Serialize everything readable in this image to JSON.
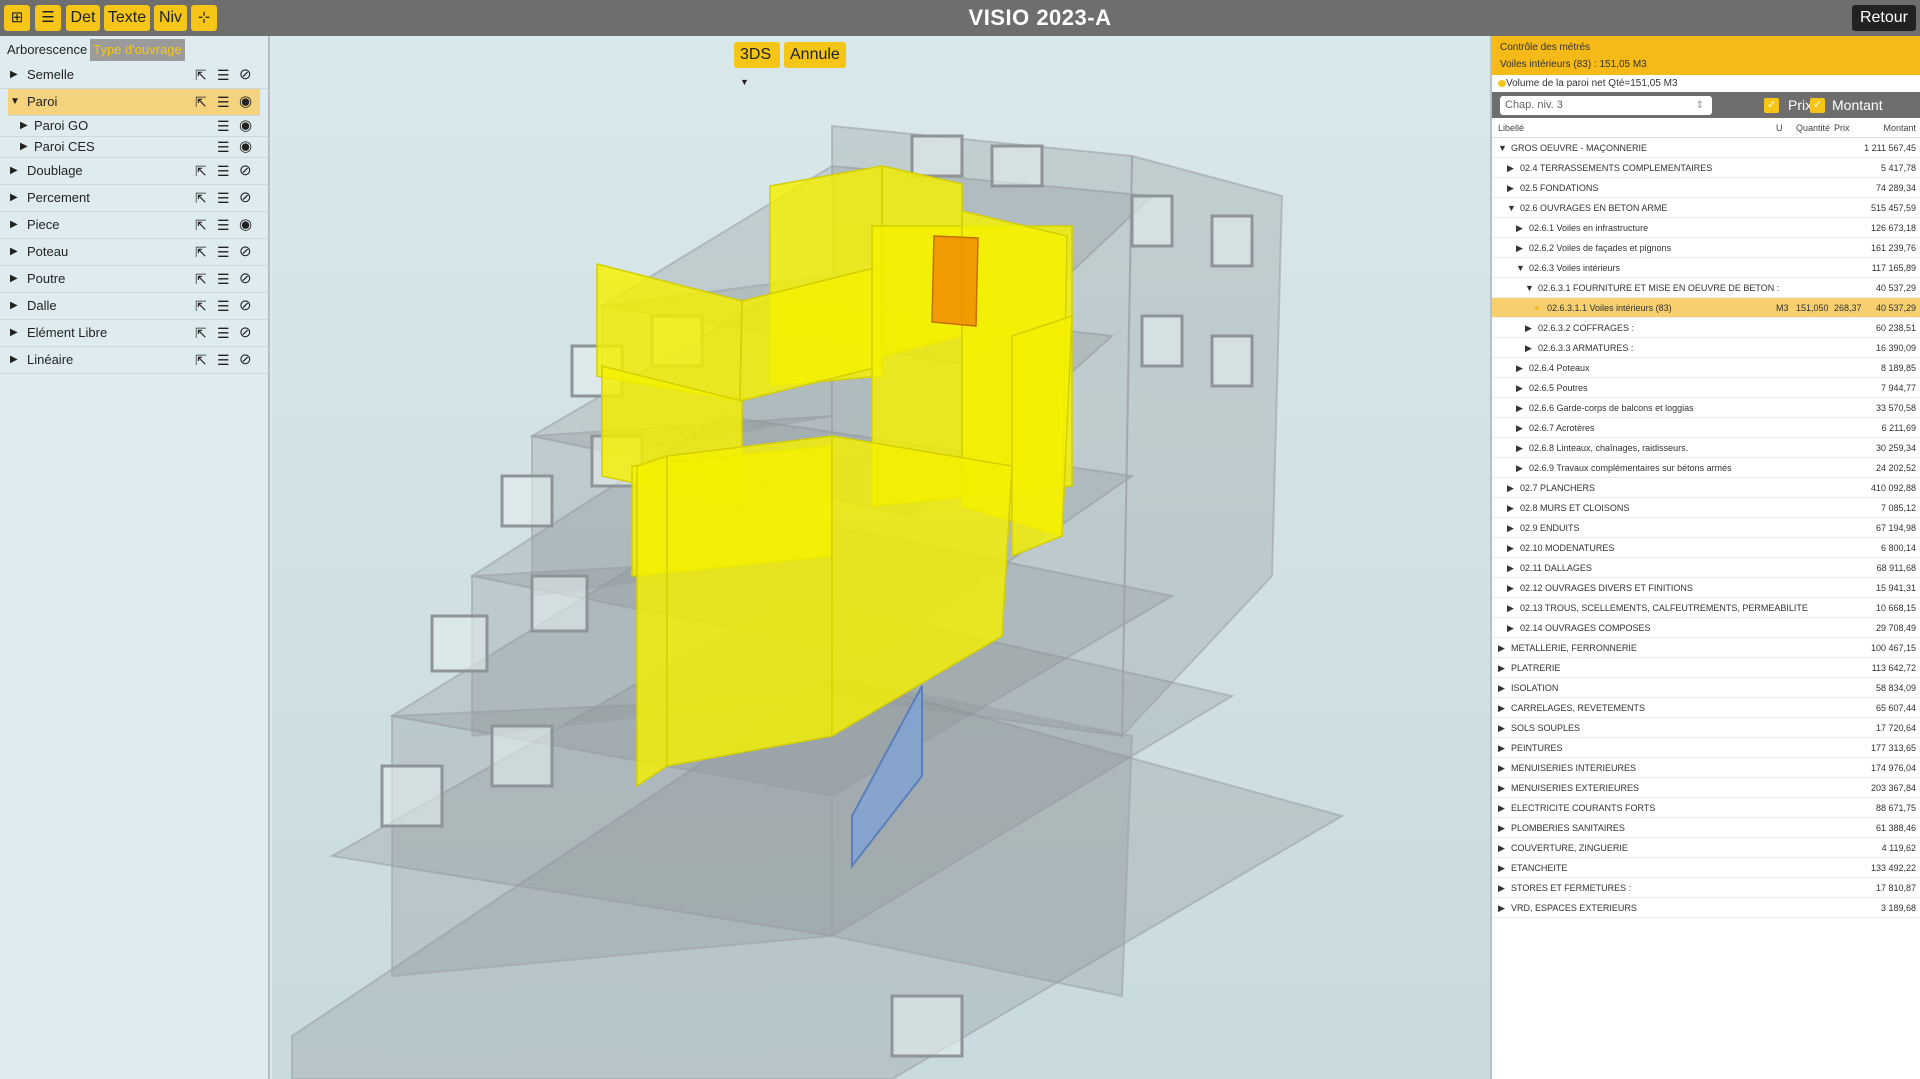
{
  "toolbar": {
    "icon_tree": "tree-icon",
    "icon_list": "list-icon",
    "det_label": "Det",
    "texte_label": "Texte",
    "niv_label": "Niv",
    "icon_collapse": "collapse-icon"
  },
  "app_title": "VISIO 2023-A",
  "retour_label": "Retour",
  "left": {
    "tabs": [
      {
        "label": "Arborescence",
        "active": false
      },
      {
        "label": "Type d'ouvrage",
        "active": true
      }
    ],
    "items": [
      {
        "label": "Semelle",
        "visible": false
      },
      {
        "label": "Paroi",
        "visible": true,
        "expanded": true
      },
      {
        "label": "Paroi GO",
        "visible": true,
        "child": true
      },
      {
        "label": "Paroi CES",
        "visible": true,
        "child": true
      },
      {
        "label": "Doublage",
        "visible": false
      },
      {
        "label": "Percement",
        "visible": false
      },
      {
        "label": "Piece",
        "visible": true
      },
      {
        "label": "Poteau",
        "visible": false
      },
      {
        "label": "Poutre",
        "visible": false
      },
      {
        "label": "Dalle",
        "visible": false
      },
      {
        "label": "Elément Libre",
        "visible": false
      },
      {
        "label": "Linéaire",
        "visible": false
      }
    ]
  },
  "viewport": {
    "view_select": "3DS",
    "annule_label": "Annule",
    "colors": {
      "selected_wall": "#f5f000",
      "highlight_wall": "#f08c00",
      "blue_element": "#7fa3d6"
    }
  },
  "right": {
    "control_title": "Contrôle des métrés",
    "control_subtitle": "Voiles intérieurs (83) : 151,05 M3",
    "control_item": "Volume de la paroi net Qté=151,05 M3",
    "chapter_select": "Chap. niv. 3",
    "prix_label": "Prix",
    "montant_label": "Montant",
    "columns": {
      "libelle": "Libellé",
      "u": "U",
      "quantite": "Quantité",
      "prix": "Prix",
      "montant": "Montant"
    },
    "rows": [
      {
        "label": "GROS OEUVRE - MAÇONNERIE",
        "montant": "1 211 567,45",
        "level": 0,
        "open": true
      },
      {
        "label": "02.4 TERRASSEMENTS COMPLEMENTAIRES",
        "montant": "5 417,78",
        "level": 1
      },
      {
        "label": "02.5 FONDATIONS",
        "montant": "74 289,34",
        "level": 1
      },
      {
        "label": "02.6 OUVRAGES EN BETON ARME",
        "montant": "515 457,59",
        "level": 1,
        "open": true
      },
      {
        "label": "02.6.1 Voiles en infrastructure",
        "montant": "126 673,18",
        "level": 2
      },
      {
        "label": "02.6.2 Voiles de façades et pignons",
        "montant": "161 239,76",
        "level": 2
      },
      {
        "label": "02.6.3 Voiles intérieurs",
        "montant": "117 165,89",
        "level": 2,
        "open": true
      },
      {
        "label": "02.6.3.1 FOURNITURE ET MISE EN OEUVRE DE BETON :",
        "montant": "40 537,29",
        "level": 3,
        "open": true
      },
      {
        "label": "02.6.3.1.1 Voiles intérieurs (83)",
        "u": "M3",
        "quantite": "151,050",
        "prix": "268,37",
        "montant": "40 537,29",
        "level": 4,
        "highlight": true
      },
      {
        "label": "02.6.3.2 COFFRAGES :",
        "montant": "60 238,51",
        "level": 3
      },
      {
        "label": "02.6.3.3 ARMATURES :",
        "montant": "16 390,09",
        "level": 3
      },
      {
        "label": "02.6.4 Poteaux",
        "montant": "8 189,85",
        "level": 2
      },
      {
        "label": "02.6.5 Poutres",
        "montant": "7 944,77",
        "level": 2
      },
      {
        "label": "02.6.6 Garde-corps de balcons et loggias",
        "montant": "33 570,58",
        "level": 2
      },
      {
        "label": "02.6.7 Acrotères",
        "montant": "6 211,69",
        "level": 2
      },
      {
        "label": "02.6.8 Linteaux, chaînages, raidisseurs.",
        "montant": "30 259,34",
        "level": 2
      },
      {
        "label": "02.6.9 Travaux complémentaires sur bétons armés",
        "montant": "24 202,52",
        "level": 2
      },
      {
        "label": "02.7 PLANCHERS",
        "montant": "410 092,88",
        "level": 1
      },
      {
        "label": "02.8 MURS ET CLOISONS",
        "montant": "7 085,12",
        "level": 1
      },
      {
        "label": "02.9 ENDUITS",
        "montant": "67 194,98",
        "level": 1
      },
      {
        "label": "02.10 MODENATURES",
        "montant": "6 800,14",
        "level": 1
      },
      {
        "label": "02.11 DALLAGES",
        "montant": "68 911,68",
        "level": 1
      },
      {
        "label": "02.12 OUVRAGES DIVERS ET FINITIONS",
        "montant": "15 941,31",
        "level": 1
      },
      {
        "label": "02.13 TROUS, SCELLEMENTS, CALFEUTREMENTS, PERMEABILITE",
        "montant": "10 668,15",
        "level": 1
      },
      {
        "label": "02.14 OUVRAGES COMPOSES",
        "montant": "29 708,49",
        "level": 1
      },
      {
        "label": "METALLERIE, FERRONNERIE",
        "montant": "100 467,15",
        "level": 0
      },
      {
        "label": "PLATRERIE",
        "montant": "113 642,72",
        "level": 0
      },
      {
        "label": "ISOLATION",
        "montant": "58 834,09",
        "level": 0
      },
      {
        "label": "CARRELAGES, REVETEMENTS",
        "montant": "65 607,44",
        "level": 0
      },
      {
        "label": "SOLS SOUPLES",
        "montant": "17 720,64",
        "level": 0
      },
      {
        "label": "PEINTURES",
        "montant": "177 313,65",
        "level": 0
      },
      {
        "label": "MENUISERIES INTERIEURES",
        "montant": "174 976,04",
        "level": 0
      },
      {
        "label": "MENUISERIES EXTERIEURES",
        "montant": "203 367,84",
        "level": 0
      },
      {
        "label": "ELECTRICITE COURANTS FORTS",
        "montant": "88 671,75",
        "level": 0
      },
      {
        "label": "PLOMBERIES SANITAIRES",
        "montant": "61 388,46",
        "level": 0
      },
      {
        "label": "COUVERTURE, ZINGUERIE",
        "montant": "4 119,62",
        "level": 0
      },
      {
        "label": "ETANCHEITE",
        "montant": "133 492,22",
        "level": 0
      },
      {
        "label": "STORES ET FERMETURES :",
        "montant": "17 810,87",
        "level": 0
      },
      {
        "label": "VRD, ESPACES EXTERIEURS",
        "montant": "3 189,68",
        "level": 0
      }
    ]
  }
}
